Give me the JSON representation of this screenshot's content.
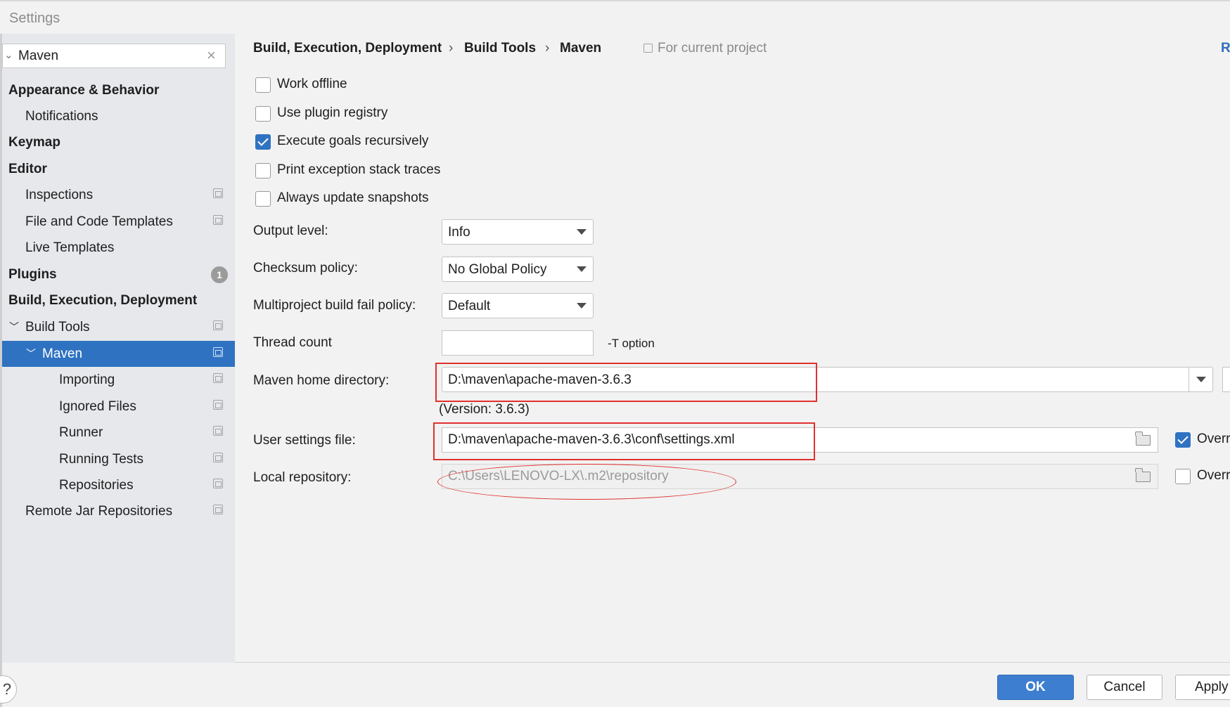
{
  "window": {
    "title": "Settings"
  },
  "search": {
    "value": "Maven"
  },
  "sidebar": {
    "items": [
      {
        "label": "Appearance & Behavior"
      },
      {
        "label": "Notifications"
      },
      {
        "label": "Keymap"
      },
      {
        "label": "Editor"
      },
      {
        "label": "Inspections"
      },
      {
        "label": "File and Code Templates"
      },
      {
        "label": "Live Templates"
      },
      {
        "label": "Plugins",
        "badge": "1"
      },
      {
        "label": "Build, Execution, Deployment"
      },
      {
        "label": "Build Tools"
      },
      {
        "label": "Maven"
      },
      {
        "label": "Importing"
      },
      {
        "label": "Ignored Files"
      },
      {
        "label": "Runner"
      },
      {
        "label": "Running Tests"
      },
      {
        "label": "Repositories"
      },
      {
        "label": "Remote Jar Repositories"
      }
    ]
  },
  "breadcrumb": {
    "items": [
      "Build, Execution, Deployment",
      "Build Tools",
      "Maven"
    ],
    "separator": "›",
    "scope": "For current project",
    "right_link": "R"
  },
  "options": {
    "work_offline": {
      "label": "Work offline",
      "checked": false
    },
    "plugin_registry": {
      "label": "Use plugin registry",
      "checked": false
    },
    "execute_recursively": {
      "label": "Execute goals recursively",
      "checked": true
    },
    "print_stack_traces": {
      "label": "Print exception stack traces",
      "checked": false
    },
    "update_snapshots": {
      "label": "Always update snapshots",
      "checked": false
    }
  },
  "form": {
    "output_level": {
      "label": "Output level:",
      "value": "Info"
    },
    "checksum_policy": {
      "label": "Checksum policy:",
      "value": "No Global Policy"
    },
    "fail_policy": {
      "label": "Multiproject build fail policy:",
      "value": "Default"
    },
    "thread_count": {
      "label": "Thread count",
      "value": "",
      "hint": "-T option"
    },
    "maven_home": {
      "label": "Maven home directory:",
      "value": "D:\\maven\\apache-maven-3.6.3",
      "version": "(Version: 3.6.3)"
    },
    "user_settings": {
      "label": "User settings file:",
      "value": "D:\\maven\\apache-maven-3.6.3\\conf\\settings.xml",
      "override_label": "Overr",
      "override_checked": true
    },
    "local_repo": {
      "label": "Local repository:",
      "value": "C:\\Users\\LENOVO-LX\\.m2\\repository",
      "override_label": "Overr",
      "override_checked": false
    }
  },
  "buttons": {
    "help": "?",
    "ok": "OK",
    "cancel": "Cancel",
    "apply": "Apply"
  },
  "colors": {
    "accent": "#2f72c2",
    "annotation": "#e0312e"
  }
}
